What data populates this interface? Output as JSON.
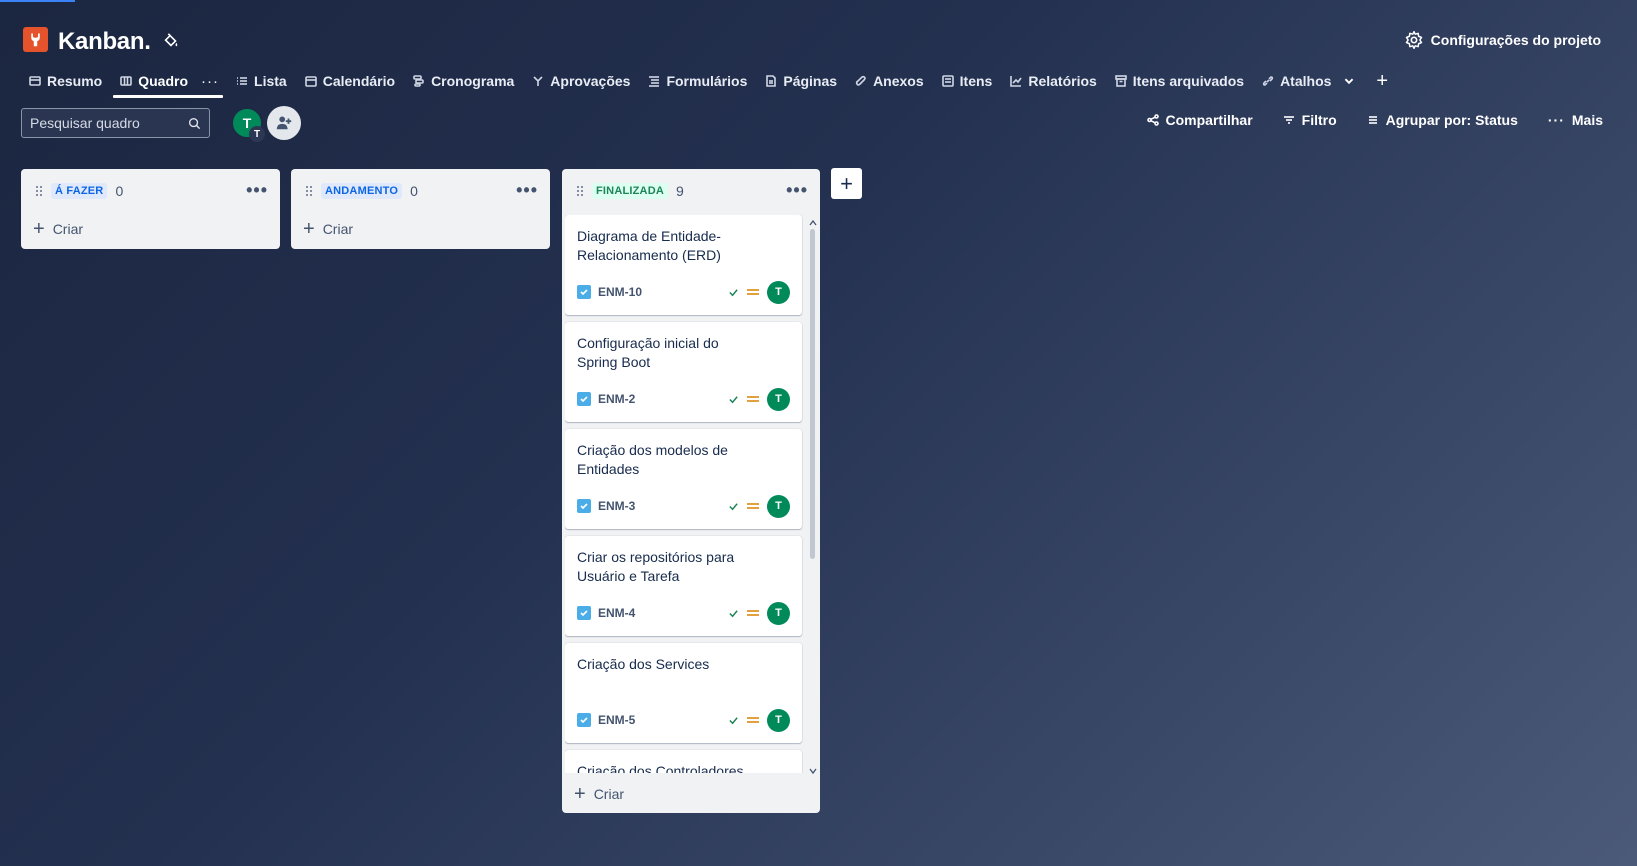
{
  "header": {
    "title": "Kanban.",
    "settings_label": "Configurações do projeto"
  },
  "tabs": [
    {
      "label": "Resumo",
      "icon": "summary-icon"
    },
    {
      "label": "Quadro",
      "icon": "board-icon",
      "active": true
    },
    {
      "label": "Lista",
      "icon": "list-icon"
    },
    {
      "label": "Calendário",
      "icon": "calendar-icon"
    },
    {
      "label": "Cronograma",
      "icon": "timeline-icon"
    },
    {
      "label": "Aprovações",
      "icon": "approvals-icon"
    },
    {
      "label": "Formulários",
      "icon": "forms-icon"
    },
    {
      "label": "Páginas",
      "icon": "pages-icon"
    },
    {
      "label": "Anexos",
      "icon": "attachment-icon"
    },
    {
      "label": "Itens",
      "icon": "items-icon"
    },
    {
      "label": "Relatórios",
      "icon": "reports-icon"
    },
    {
      "label": "Itens arquivados",
      "icon": "archive-icon"
    },
    {
      "label": "Atalhos",
      "icon": "link-icon"
    }
  ],
  "toolbar": {
    "search_placeholder": "Pesquisar quadro",
    "avatar_initial": "T",
    "avatar_sub_initial": "T",
    "share_label": "Compartilhar",
    "filter_label": "Filtro",
    "group_label": "Agrupar por: Status",
    "more_label": "Mais"
  },
  "columns": [
    {
      "name": "Á FAZER",
      "count": "0",
      "color": "blue",
      "create_label": "Criar"
    },
    {
      "name": "ANDAMENTO",
      "count": "0",
      "color": "blue",
      "create_label": "Criar"
    },
    {
      "name": "FINALIZADA",
      "count": "9",
      "color": "green",
      "create_label": "Criar"
    }
  ],
  "cards": [
    {
      "title": "Diagrama de Entidade-Relacionamento (ERD)",
      "key": "ENM-10",
      "assignee": "T"
    },
    {
      "title": "Configuração inicial do Spring Boot",
      "key": "ENM-2",
      "assignee": "T"
    },
    {
      "title": "Criação dos modelos de Entidades",
      "key": "ENM-3",
      "assignee": "T"
    },
    {
      "title": "Criar os repositórios para Usuário e Tarefa",
      "key": "ENM-4",
      "assignee": "T"
    },
    {
      "title": "Criação dos Services",
      "key": "ENM-5",
      "assignee": "T"
    },
    {
      "title": "Criação dos Controladores (Controllers)",
      "key": "",
      "assignee": ""
    }
  ],
  "colors": {
    "accent": "#0c66e4",
    "done": "#1f845a",
    "avatar": "#008a5a",
    "priority_medium": "#e2a03f",
    "logo": "#e5532d"
  }
}
